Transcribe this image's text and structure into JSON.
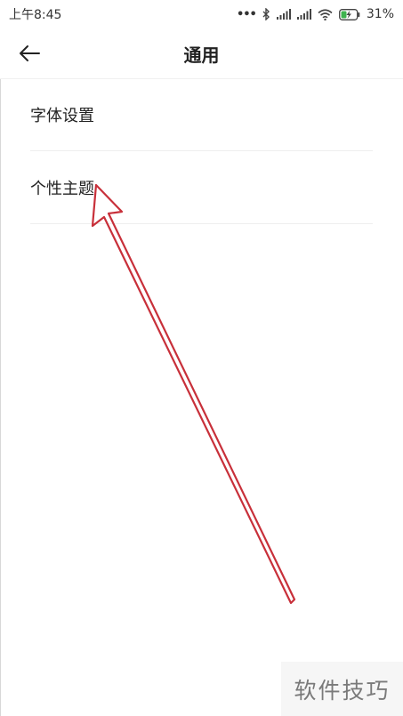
{
  "status_bar": {
    "time": "上午8:45",
    "dots": "•••",
    "battery_percent": "31%",
    "icons": [
      "bluetooth-icon",
      "signal-icon",
      "signal-icon",
      "wifi-icon",
      "battery-charging-icon"
    ]
  },
  "header": {
    "title": "通用",
    "back_icon": "arrow-left-icon"
  },
  "menu": {
    "items": [
      {
        "label": "字体设置"
      },
      {
        "label": "个性主题"
      }
    ]
  },
  "annotation": {
    "arrow_color": "#c8303a"
  },
  "watermark": {
    "text": "软件技巧"
  }
}
